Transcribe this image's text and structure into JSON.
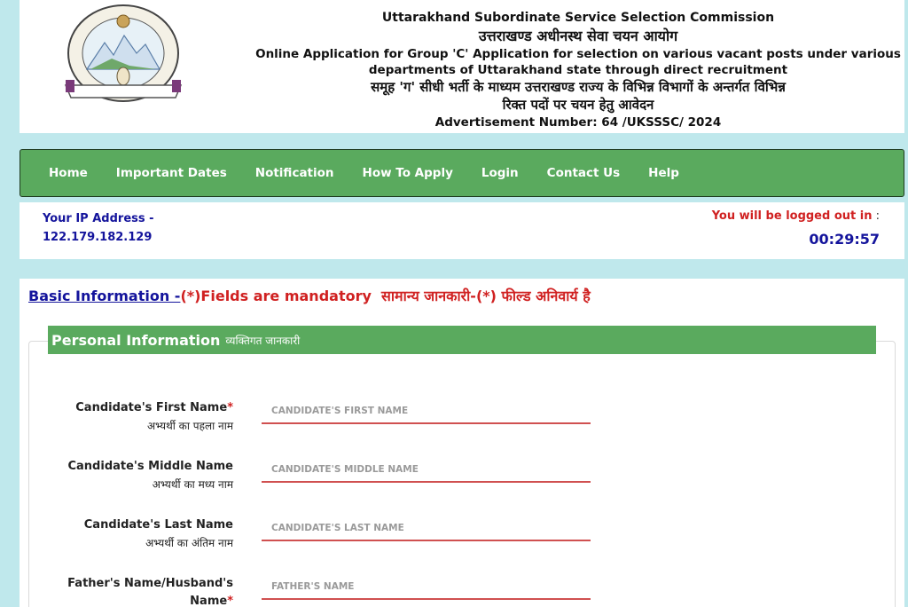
{
  "header": {
    "line1": "Uttarakhand Subordinate Service Selection Commission",
    "line2": "उत्तराखण्ड अधीनस्थ सेवा चयन आयोग",
    "line3a": "Online Application for Group 'C' Application for selection on various vacant posts under various",
    "line3b": "departments of Uttarakhand state through direct recruitment",
    "line4a": "समूह 'ग' सीधी भर्ती के माध्यम उत्तराखण्ड राज्य के विभिन्न विभागों के अन्तर्गत विभिन्न",
    "line4b": "रिक्त पदों पर चयन हेतु आवेदन",
    "advertisement": "Advertisement Number: 64 /UKSSSC/ 2024"
  },
  "nav": {
    "items": [
      {
        "label": "Home"
      },
      {
        "label": "Important Dates"
      },
      {
        "label": "Notification"
      },
      {
        "label": "How To Apply"
      },
      {
        "label": "Login"
      },
      {
        "label": "Contact Us"
      },
      {
        "label": "Help"
      }
    ]
  },
  "session": {
    "ip_label": "Your IP Address -",
    "ip_value": "122.179.182.129",
    "logout_label": "You will be logged out in",
    "logout_colon": " :",
    "timer": "00:29:57"
  },
  "form": {
    "basic_link": "Basic Information -",
    "mandatory_en": "(*)Fields are mandatory",
    "mandatory_hi": "सामान्य जानकारी-(*) फील्ड अनिवार्य है",
    "section_title": "Personal Information",
    "section_sub": "व्यक्तिगत जानकारी",
    "required_mark": "*",
    "fields": [
      {
        "label": "Candidate's First Name",
        "sub": "अभ्यर्थी का पहला नाम",
        "placeholder": "CANDIDATE'S FIRST NAME",
        "value": ""
      },
      {
        "label": "Candidate's Middle Name",
        "sub": "अभ्यर्थी का मध्य नाम",
        "placeholder": "CANDIDATE'S MIDDLE NAME",
        "value": ""
      },
      {
        "label": "Candidate's Last Name",
        "sub": "अभ्यर्थी का अंतिम नाम",
        "placeholder": "CANDIDATE'S LAST NAME",
        "value": ""
      },
      {
        "label": "Father's Name/Husband's",
        "sub": "Name",
        "placeholder": "FATHER'S NAME",
        "value": ""
      }
    ]
  },
  "colors": {
    "green": "#5aaa5e",
    "navy": "#14149c",
    "red": "#d02121",
    "background": "#bfe8ec"
  },
  "icons": {
    "logo": "uksssc-emblem"
  }
}
